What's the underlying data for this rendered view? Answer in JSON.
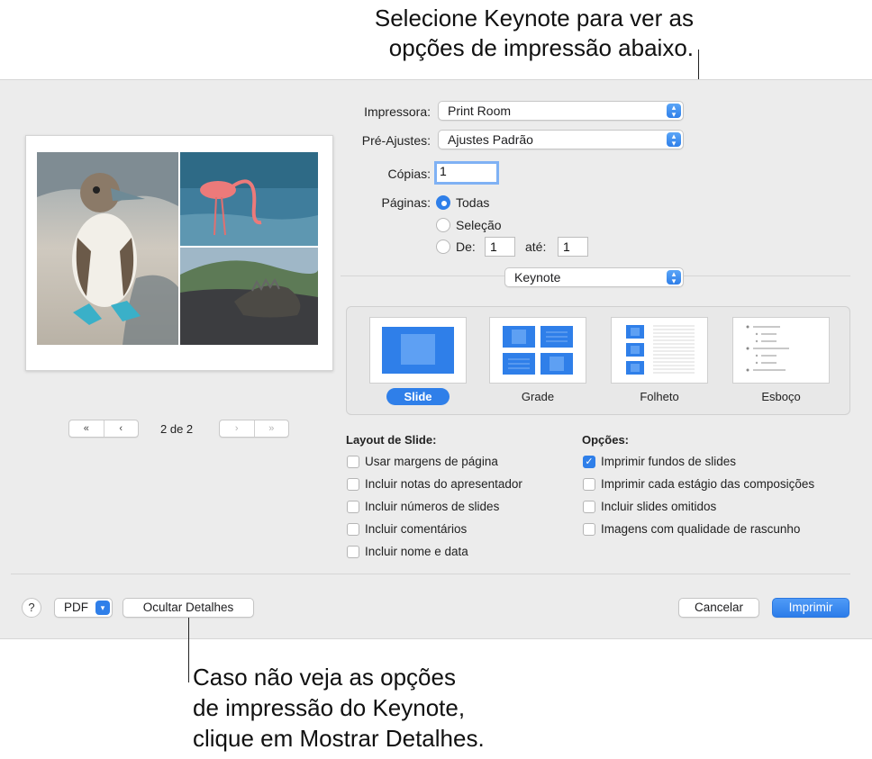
{
  "callouts": {
    "top_line1": "Selecione Keynote para ver as",
    "top_line2": "opções de impressão abaixo.",
    "bottom_line1": "Caso não veja as opções",
    "bottom_line2": "de impressão do Keynote,",
    "bottom_line3": "clique em Mostrar Detalhes."
  },
  "preview": {
    "page_nav": {
      "first": "«",
      "prev": "‹",
      "next": "›",
      "last": "»",
      "page_count": "2 de 2"
    }
  },
  "printer": {
    "label": "Impressora:",
    "value": "Print Room"
  },
  "presets": {
    "label": "Pré-Ajustes:",
    "value": "Ajustes Padrão"
  },
  "copies": {
    "label": "Cópias:",
    "value": "1"
  },
  "pages": {
    "label": "Páginas:",
    "all": "Todas",
    "selection": "Seleção",
    "from": "De:",
    "from_value": "1",
    "to": "até:",
    "to_value": "1",
    "selected": "all"
  },
  "app_popup": {
    "value": "Keynote"
  },
  "layouts": [
    {
      "label": "Slide",
      "selected": true
    },
    {
      "label": "Grade",
      "selected": false
    },
    {
      "label": "Folheto",
      "selected": false
    },
    {
      "label": "Esboço",
      "selected": false
    }
  ],
  "slide_layout": {
    "title": "Layout de Slide:",
    "items": [
      {
        "label": "Usar margens de página",
        "checked": false
      },
      {
        "label": "Incluir notas do apresentador",
        "checked": false
      },
      {
        "label": "Incluir números de slides",
        "checked": false
      },
      {
        "label": "Incluir comentários",
        "checked": false
      },
      {
        "label": "Incluir nome e data",
        "checked": false
      }
    ]
  },
  "options": {
    "title": "Opções:",
    "items": [
      {
        "label": "Imprimir fundos de slides",
        "checked": true
      },
      {
        "label": "Imprimir cada estágio das composições",
        "checked": false
      },
      {
        "label": "Incluir slides omitidos",
        "checked": false
      },
      {
        "label": "Imagens com qualidade de rascunho",
        "checked": false
      }
    ]
  },
  "footer": {
    "help": "?",
    "pdf": "PDF",
    "hide_details": "Ocultar Detalhes",
    "cancel": "Cancelar",
    "print": "Imprimir"
  },
  "colors": {
    "accent": "#2f7fe9",
    "dialog_bg": "#ececec"
  }
}
